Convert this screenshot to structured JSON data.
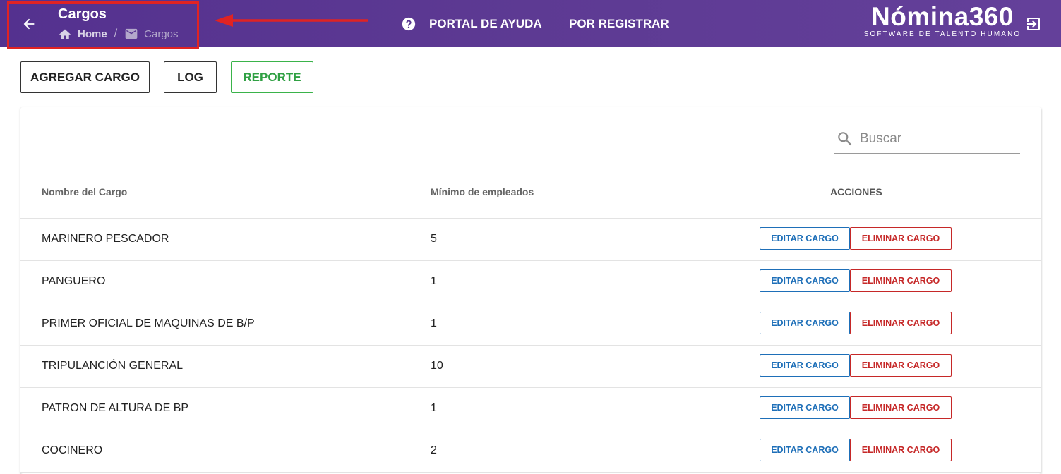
{
  "header": {
    "title": "Cargos",
    "breadcrumb": {
      "home": "Home",
      "current": "Cargos"
    },
    "help_link": "PORTAL DE AYUDA",
    "register_link": "POR REGISTRAR",
    "brand": {
      "name": "Nómina360",
      "tagline": "SOFTWARE DE TALENTO HUMANO"
    },
    "highlight_color": "#e02323",
    "bar_color": "#5a3892"
  },
  "toolbar": {
    "add_label": "AGREGAR CARGO",
    "log_label": "LOG",
    "report_label": "REPORTE"
  },
  "table": {
    "search_placeholder": "Buscar",
    "columns": {
      "name": "Nombre del Cargo",
      "min": "Mínimo de empleados",
      "actions": "ACCIONES"
    },
    "edit_label": "EDITAR CARGO",
    "delete_label": "ELIMINAR CARGO",
    "rows": [
      {
        "name": "MARINERO PESCADOR",
        "min": "5"
      },
      {
        "name": "PANGUERO",
        "min": "1"
      },
      {
        "name": "PRIMER OFICIAL DE MAQUINAS DE B/P",
        "min": "1"
      },
      {
        "name": "TRIPULANCIÓN GENERAL",
        "min": "10"
      },
      {
        "name": "PATRON DE ALTURA DE BP",
        "min": "1"
      },
      {
        "name": "COCINERO",
        "min": "2"
      }
    ]
  }
}
